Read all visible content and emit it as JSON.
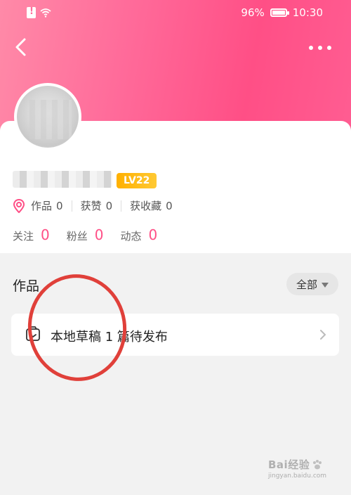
{
  "status_bar": {
    "battery_percent": "96%",
    "time": "10:30",
    "icons": [
      "sim-alert-icon",
      "wifi-icon",
      "battery-icon"
    ]
  },
  "nav": {
    "back_icon": "chevron-left-icon",
    "more_icon": "more-icon"
  },
  "profile": {
    "level_badge": "LV22",
    "stats": [
      {
        "label": "作品",
        "value": "0"
      },
      {
        "label": "获赞",
        "value": "0"
      },
      {
        "label": "获收藏",
        "value": "0"
      }
    ],
    "follow": [
      {
        "label": "关注",
        "value": "0"
      },
      {
        "label": "粉丝",
        "value": "0"
      },
      {
        "label": "动态",
        "value": "0"
      }
    ]
  },
  "works": {
    "title": "作品",
    "filter": "全部",
    "draft_text": "本地草稿 1 篇待发布"
  },
  "watermark": {
    "brand": "Bai经验",
    "url": "jingyan.baidu.com"
  },
  "colors": {
    "header_gradient_start": "#ff8aa8",
    "header_gradient_end": "#ff4f86",
    "accent": "#ff4f86",
    "badge": "#ffb000",
    "annotation": "#e0403a"
  }
}
